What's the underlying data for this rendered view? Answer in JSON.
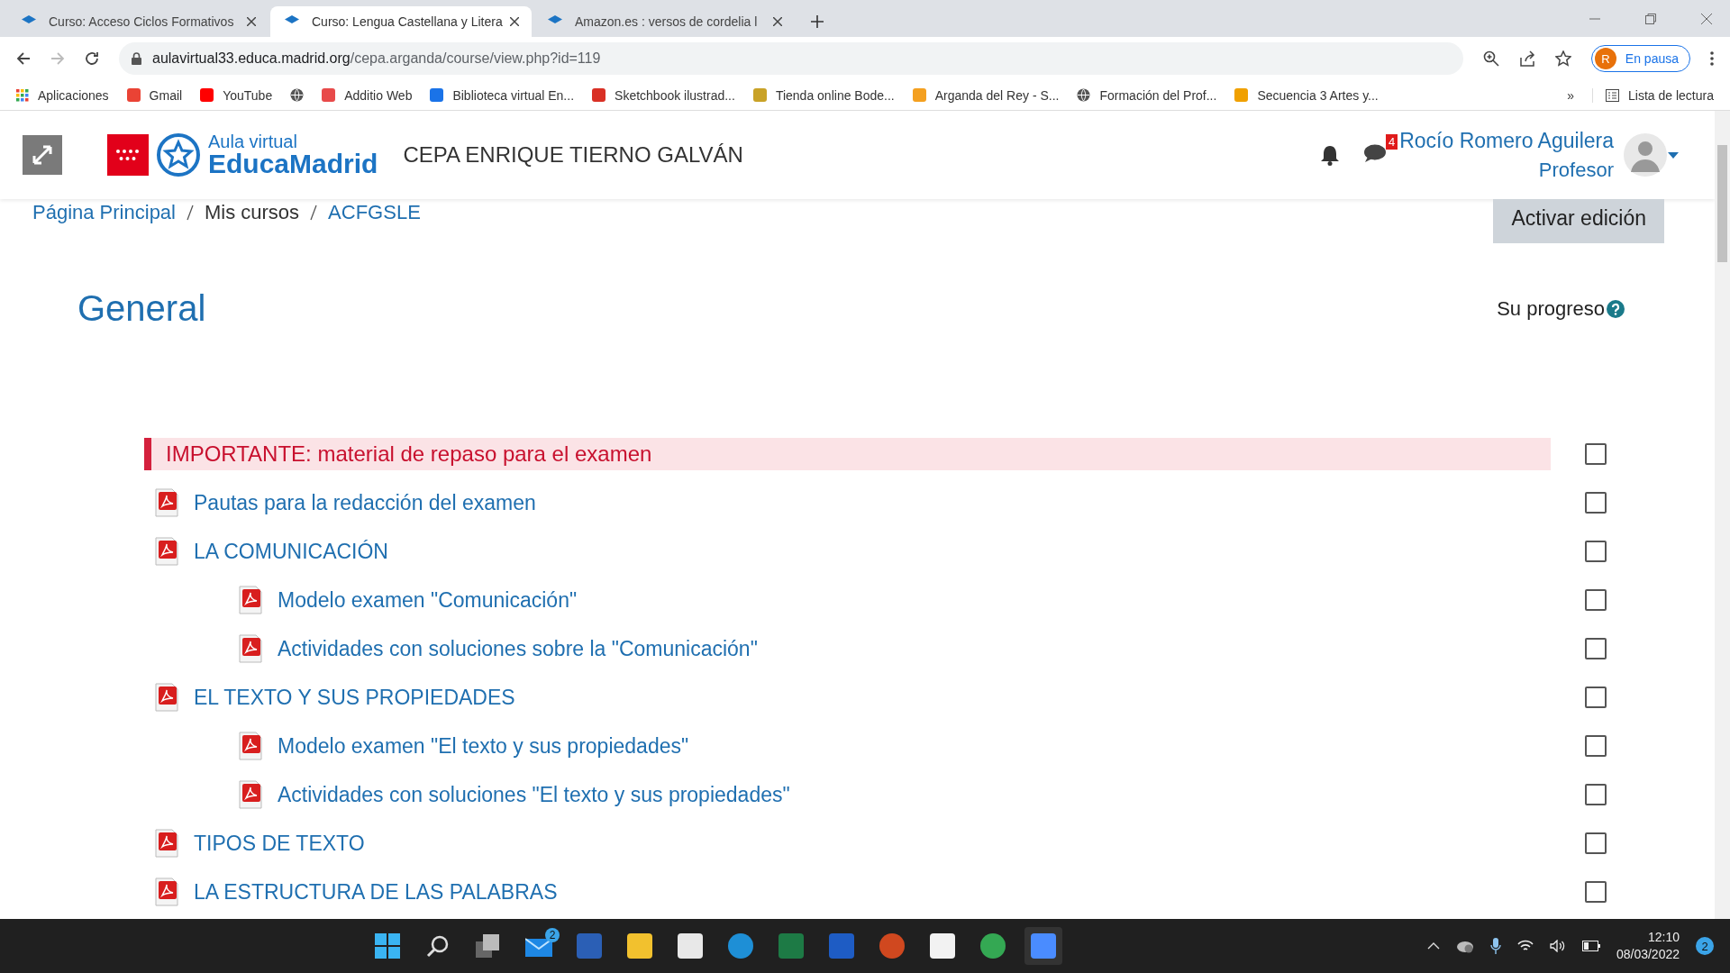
{
  "browser": {
    "tabs": [
      {
        "title": "Curso: Acceso Ciclos Formativos",
        "selected": false
      },
      {
        "title": "Curso: Lengua Castellana y Litera",
        "selected": true
      },
      {
        "title": "Amazon.es : versos de cordelia l",
        "selected": false
      }
    ],
    "address": {
      "domain": "aulavirtual33.educa.madrid.org",
      "path": "/cepa.arganda/course/view.php?id=119"
    },
    "profile": {
      "initial": "R",
      "label": "En pausa"
    },
    "bookmarks": [
      "Aplicaciones",
      "Gmail",
      "YouTube",
      "Additio Web",
      "Biblioteca virtual En...",
      "Sketchbook ilustrad...",
      "Tienda online Bode...",
      "Arganda del Rey - S...",
      "Formación del Prof...",
      "Secuencia 3 Artes y..."
    ],
    "bookmarks_more": "»",
    "reading_list": "Lista de lectura"
  },
  "header": {
    "logo_top": "Aula virtual",
    "logo_bottom": "EducaMadrid",
    "site": "CEPA ENRIQUE TIERNO GALVÁN",
    "messages_badge": "4",
    "user_name": "Rocío Romero Aguilera",
    "user_role": "Profesor"
  },
  "breadcrumb": [
    {
      "label": "Página Principal",
      "link": true
    },
    {
      "label": "Mis cursos",
      "link": false
    },
    {
      "label": "ACFGSLE",
      "link": true
    }
  ],
  "edit_button": "Activar edición",
  "section": {
    "title": "General",
    "progress_label": "Su progreso"
  },
  "activities": [
    {
      "kind": "label",
      "title": "IMPORTANTE: material de repaso para el examen",
      "checked": false
    },
    {
      "kind": "file",
      "title": "Pautas para la redacción del examen",
      "checked": false
    },
    {
      "kind": "file",
      "title": "LA COMUNICACIÓN",
      "checked": false,
      "children": [
        {
          "kind": "file",
          "title": "Modelo examen \"Comunicación\"",
          "checked": false
        },
        {
          "kind": "file",
          "title": "Actividades con soluciones sobre la \"Comunicación\"",
          "checked": false
        }
      ]
    },
    {
      "kind": "file",
      "title": "EL TEXTO Y SUS PROPIEDADES",
      "checked": false,
      "children": [
        {
          "kind": "file",
          "title": "Modelo examen \"El texto y sus propiedades\"",
          "checked": false
        },
        {
          "kind": "file",
          "title": "Actividades con soluciones \"El texto y sus propiedades\"",
          "checked": false
        }
      ]
    },
    {
      "kind": "file",
      "title": "TIPOS DE TEXTO",
      "checked": false
    },
    {
      "kind": "file",
      "title": "LA ESTRUCTURA DE LAS PALABRAS",
      "checked": false
    }
  ],
  "taskbar": {
    "mail_badge": "2",
    "time": "12:10",
    "date": "08/03/2022",
    "notifications": "2"
  }
}
